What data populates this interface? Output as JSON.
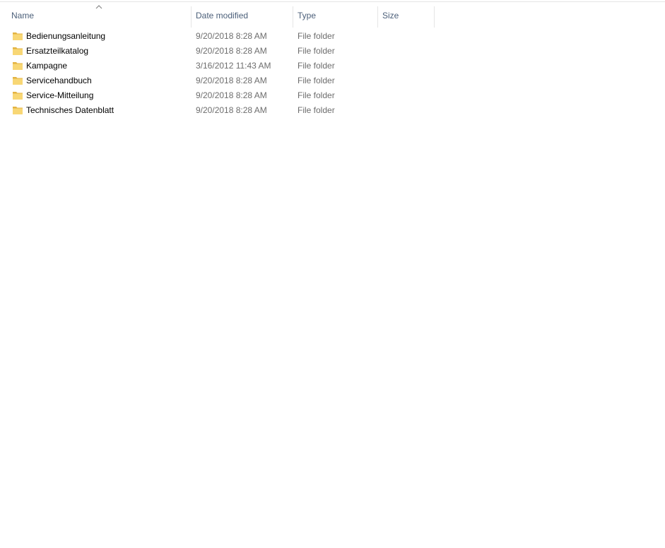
{
  "columns": {
    "name": "Name",
    "date_modified": "Date modified",
    "type": "Type",
    "size": "Size",
    "sort_indicator": "ascending-by-name"
  },
  "colors": {
    "header_text": "#4c607a",
    "detail_text": "#6d6d6d",
    "folder_yellow": "#f8d775",
    "folder_dark": "#e3b342"
  },
  "files": [
    {
      "name": "Bedienungsanleitung",
      "date": "9/20/2018 8:28 AM",
      "type": "File folder",
      "size": "",
      "icon": "folder-icon"
    },
    {
      "name": "Ersatzteilkatalog",
      "date": "9/20/2018 8:28 AM",
      "type": "File folder",
      "size": "",
      "icon": "folder-icon"
    },
    {
      "name": "Kampagne",
      "date": "3/16/2012 11:43 AM",
      "type": "File folder",
      "size": "",
      "icon": "folder-icon"
    },
    {
      "name": "Servicehandbuch",
      "date": "9/20/2018 8:28 AM",
      "type": "File folder",
      "size": "",
      "icon": "folder-icon"
    },
    {
      "name": "Service-Mitteilung",
      "date": "9/20/2018 8:28 AM",
      "type": "File folder",
      "size": "",
      "icon": "folder-icon"
    },
    {
      "name": "Technisches Datenblatt",
      "date": "9/20/2018 8:28 AM",
      "type": "File folder",
      "size": "",
      "icon": "folder-icon"
    }
  ]
}
